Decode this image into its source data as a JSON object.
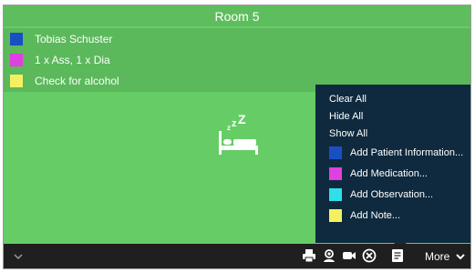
{
  "room": {
    "title": "Room 5"
  },
  "notes": [
    {
      "label": "Tobias Schuster",
      "color": "#1a4fc4"
    },
    {
      "label": "1 x Ass, 1 x Dia",
      "color": "#e040e0"
    },
    {
      "label": "Check for alcohol",
      "color": "#f5f060"
    }
  ],
  "main": {
    "status_icon": "sleeping-bed-icon"
  },
  "menu": {
    "clear_all": "Clear All",
    "hide_all": "Hide All",
    "show_all": "Show All",
    "add_items": [
      {
        "label": "Add Patient Information...",
        "color": "#1a4fc4"
      },
      {
        "label": "Add Medication...",
        "color": "#e040e0"
      },
      {
        "label": "Add Observation...",
        "color": "#30e0e8"
      },
      {
        "label": "Add Note...",
        "color": "#f5f060"
      }
    ]
  },
  "toolbar": {
    "icons": [
      "printer-icon",
      "intercom-icon",
      "video-camera-icon",
      "close-circle-icon",
      "note-icon"
    ],
    "more_label": "More"
  },
  "colors": {
    "room_background": "#66cc66",
    "title_bar": "#5ebe5e",
    "notes_area": "#5bb85b",
    "menu_background": "#0f2a3e",
    "toolbar_background": "#1f1f1f"
  }
}
